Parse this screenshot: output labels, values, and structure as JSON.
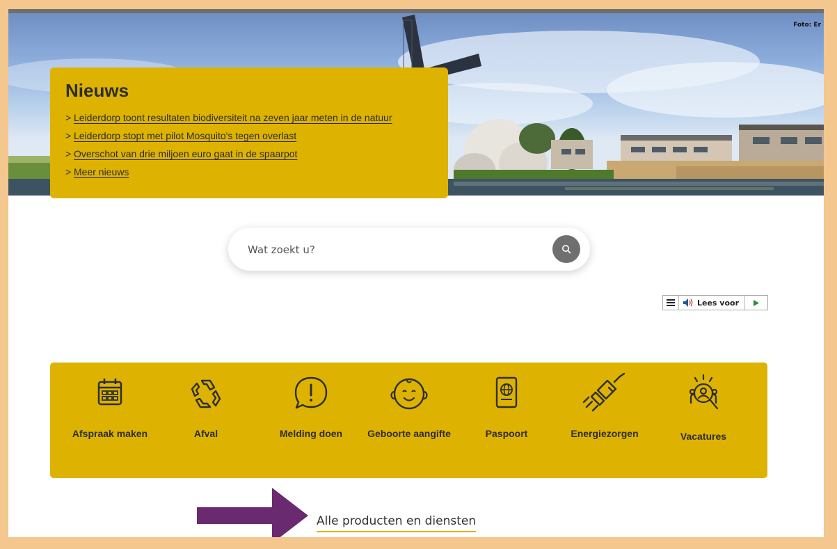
{
  "hero": {
    "photo_credit": "Foto: Er"
  },
  "news": {
    "title": "Nieuws",
    "items": [
      {
        "chevron": ">",
        "label": "Leiderdorp toont resultaten biodiversiteit na zeven jaar meten in de natuur"
      },
      {
        "chevron": ">",
        "label": "Leiderdorp stopt met pilot Mosquito's tegen overlast"
      },
      {
        "chevron": ">",
        "label": "Overschot van drie miljoen euro gaat in de spaarpot"
      },
      {
        "chevron": ">",
        "label": "Meer nieuws"
      }
    ]
  },
  "search": {
    "placeholder": "Wat zoekt u?",
    "value": "",
    "button_icon": "search-icon"
  },
  "readspeaker": {
    "menu_icon": "menu-icon",
    "speaker_icon": "speaker-icon",
    "label": "Lees voor",
    "play_icon": "play-icon"
  },
  "services": {
    "items": [
      {
        "icon": "calendar-icon",
        "label": "Afspraak maken"
      },
      {
        "icon": "recycle-icon",
        "label": "Afval"
      },
      {
        "icon": "exclamation-bubble-icon",
        "label": "Melding doen"
      },
      {
        "icon": "baby-face-icon",
        "label": "Geboorte aangifte"
      },
      {
        "icon": "passport-icon",
        "label": "Paspoort"
      },
      {
        "icon": "plug-icon",
        "label": "Energiezorgen"
      },
      {
        "icon": "job-search-icon",
        "label": "Vacatures"
      }
    ]
  },
  "all_products": {
    "label": "Alle producten en diensten"
  },
  "colors": {
    "accent_yellow": "#ddb201",
    "outer_frame": "#f3c78e",
    "annotation_arrow": "#6a2a6f",
    "text_dark": "#2e2e2e",
    "search_button": "#6f6f6f"
  }
}
